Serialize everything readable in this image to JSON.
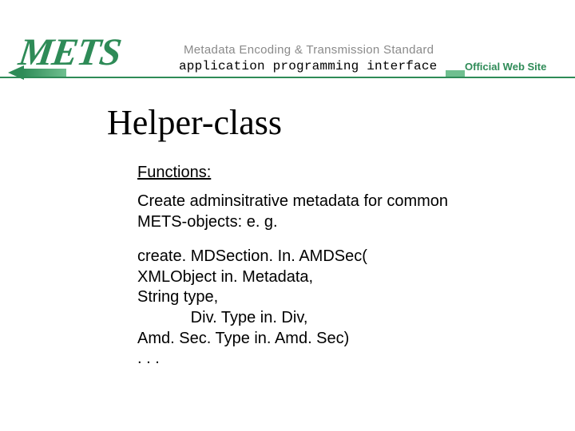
{
  "header": {
    "logo_text": "METS",
    "subtitle_top": "Metadata Encoding & Transmission Standard",
    "subtitle_api": "application programming interface",
    "official": "Official Web Site"
  },
  "main": {
    "title": "Helper-class",
    "section_label": "Functions:",
    "description": "Create adminsitrative metadata  for common METS-objects: e. g.",
    "code": "create. MDSection. In. AMDSec(\nXMLObject in. Metadata,\nString type,\n            Div. Type in. Div,\nAmd. Sec. Type in. Amd. Sec)\n. . ."
  }
}
